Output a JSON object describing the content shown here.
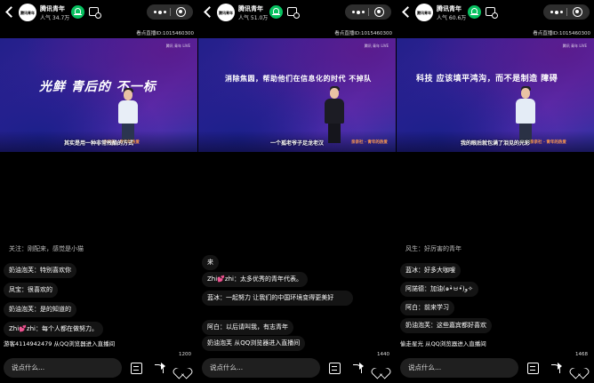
{
  "channel": {
    "avatar_text": "腾讯青年",
    "name": "腾讯青年"
  },
  "panels": [
    {
      "popularity": "人气 34.7万",
      "room_id": "看点直播ID:1015460300",
      "screen_text": "光鲜 青后的 不一标",
      "subtitle": "其实是用一种非常残酷的方式",
      "brand_text": "亲亲社 · 青年的热爱",
      "stage_logo": "腾讯 青年 LIVE",
      "comments": [
        {
          "text": "关注：刚配来，感觉是小猫"
        },
        {
          "text": "奶油泡芙：特别喜欢你"
        },
        {
          "text": "凤宝：很喜欢的"
        },
        {
          "text": "奶油泡芙：是的知道的"
        },
        {
          "text": "Zhi💕zhi：每个人都在做努力。"
        }
      ],
      "join_text": "游客4114942479 从QQ浏览器进入直播间",
      "count": "1200",
      "input_placeholder": "说点什么..."
    },
    {
      "popularity": "人气 51.0万",
      "room_id": "看点直播ID:1015460300",
      "screen_text": "消除焦圆，帮助他们在信息化的时代 不掉队",
      "subtitle": "一个孤老爷子足龙老汉",
      "brand_text": "亲亲社 · 青年的热爱",
      "stage_logo": "腾讯 青年 LIVE",
      "comments": [
        {
          "text": "来"
        },
        {
          "text": "Zhi💕zhi：太多优秀的青年代表。"
        },
        {
          "text": "蓝冰：一起努力 让我们的中国环境变得更美好"
        },
        {
          "text": "阿白：以后请叫我，有志青年"
        },
        {
          "text": "奶油泡芙 从QQ浏览器进入直播间"
        }
      ],
      "join_text": "",
      "count": "1440",
      "input_placeholder": "说点什么..."
    },
    {
      "popularity": "人气 60.6万",
      "room_id": "看点直播ID:1015460300",
      "screen_text": "科技 应该填平鸿沟，而不是制造 障碍",
      "subtitle": "我的眼后就包满了泪见的光彩",
      "brand_text": "亲亲社 · 青年的热爱",
      "stage_logo": "腾讯 青年 LIVE",
      "comments": [
        {
          "text": "风生：好厉害的青年"
        },
        {
          "text": "蓝冰：好多大咖嗖"
        },
        {
          "text": "阿諾德：加油(๑•̀ㅂ•́)و✧"
        },
        {
          "text": "阿白：前来学习"
        },
        {
          "text": "奶油泡芙：这些嘉宾都好喜欢"
        }
      ],
      "join_text": "偷走星光 从QQ浏览器进入直播间",
      "count": "1468",
      "input_placeholder": "说点什么..."
    }
  ]
}
